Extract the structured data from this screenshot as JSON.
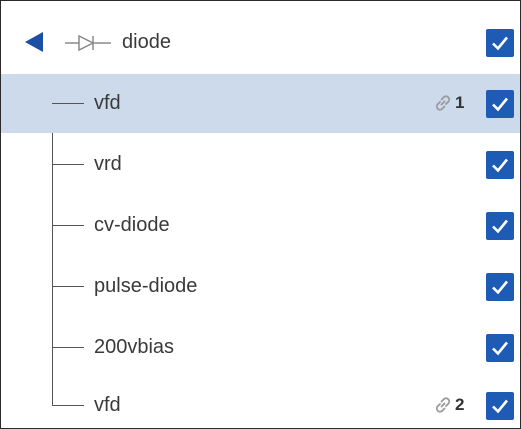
{
  "tree": {
    "parent": {
      "label": "diode",
      "icon": "diode-icon",
      "expanded": true,
      "checked": true
    },
    "children": [
      {
        "label": "vfd",
        "checked": true,
        "selected": true,
        "link_count": "1"
      },
      {
        "label": "vrd",
        "checked": true
      },
      {
        "label": "cv-diode",
        "checked": true
      },
      {
        "label": "pulse-diode",
        "checked": true
      },
      {
        "label": "200vbias",
        "checked": true
      },
      {
        "label": "vfd",
        "checked": true,
        "link_count": "2"
      }
    ]
  },
  "colors": {
    "accent": "#1d5bb4",
    "selected_row": "#ccdaec",
    "collapse_arrow": "#1a4fa3"
  }
}
